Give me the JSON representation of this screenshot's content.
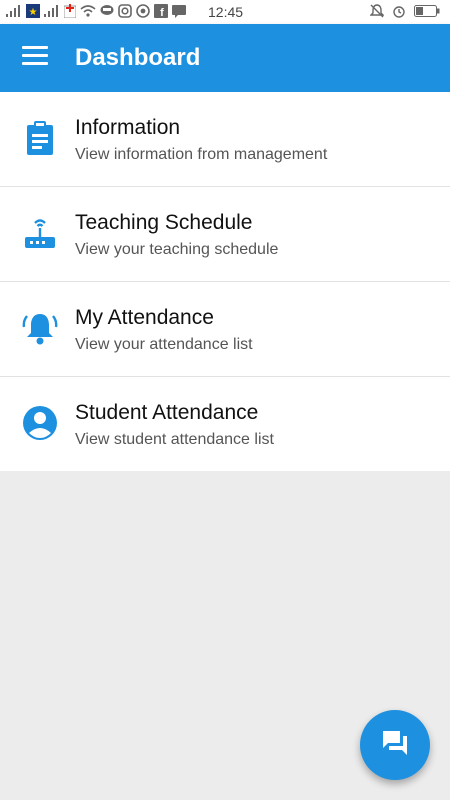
{
  "status_bar": {
    "time": "12:45",
    "left_icons": [
      "signal-icon",
      "sim-icon",
      "signal-icon",
      "notification-icon",
      "wifi-icon",
      "line-icon",
      "instagram-icon",
      "whatsapp-icon",
      "facebook-icon",
      "message-icon"
    ],
    "right_icons": [
      "silent-icon",
      "alarm-icon",
      "battery-icon"
    ]
  },
  "app_bar": {
    "title": "Dashboard",
    "menu_icon": "menu-icon",
    "color": "#1e90e0"
  },
  "menu": {
    "items": [
      {
        "icon": "clipboard-icon",
        "title": "Information",
        "subtitle": "View information from management"
      },
      {
        "icon": "router-icon",
        "title": "Teaching Schedule",
        "subtitle": "View your teaching schedule"
      },
      {
        "icon": "bell-icon",
        "title": "My Attendance",
        "subtitle": "View your attendance list"
      },
      {
        "icon": "account-circle-icon",
        "title": "Student Attendance",
        "subtitle": "View student attendance list"
      }
    ]
  },
  "fab": {
    "icon": "chat-icon"
  }
}
